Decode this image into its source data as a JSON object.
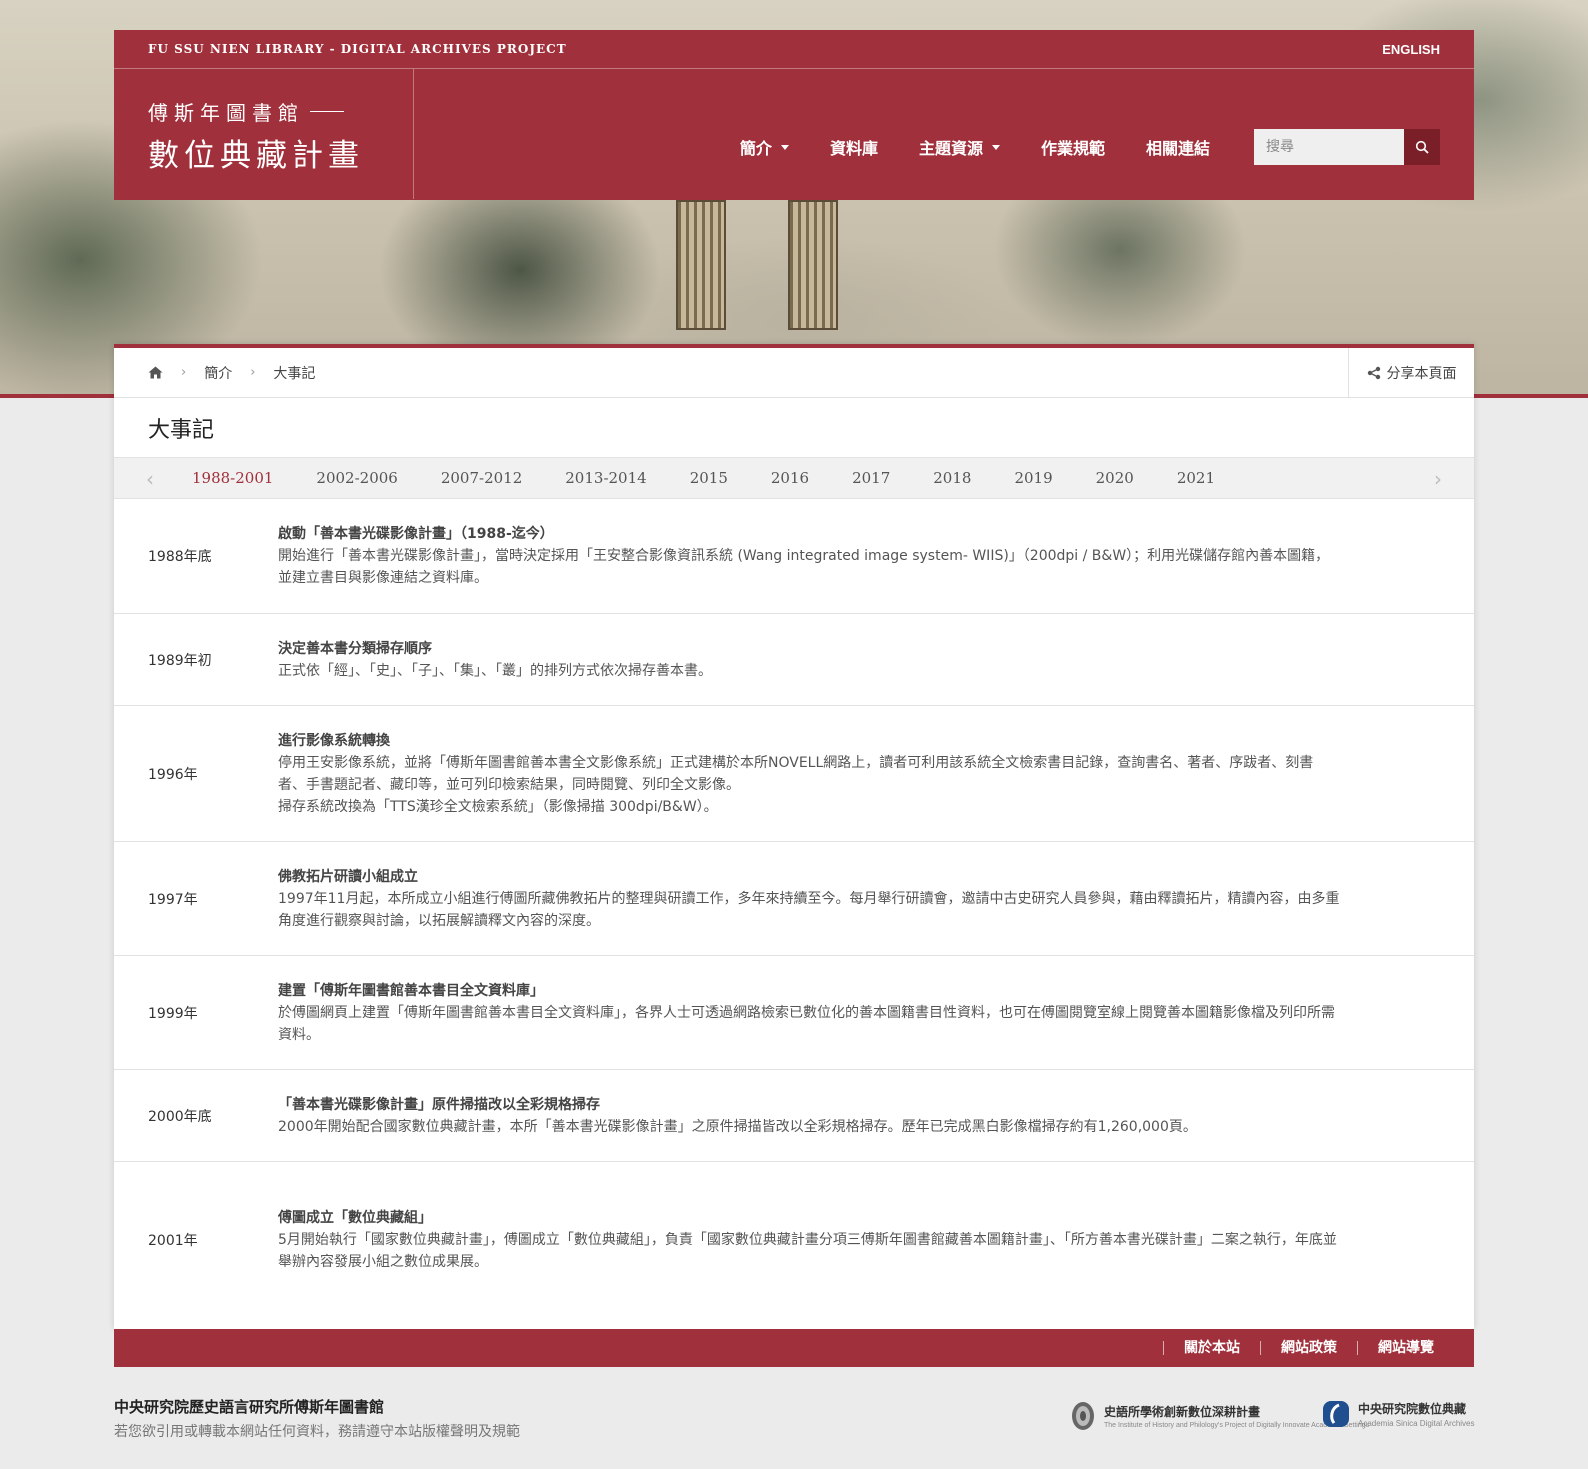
{
  "header": {
    "project_label": "FU SSU NIEN LIBRARY - DIGITAL ARCHIVES PROJECT",
    "language_link": "ENGLISH",
    "logo_line1": "傅斯年圖書館",
    "logo_line2": "數位典藏計畫",
    "nav": [
      {
        "label": "簡介",
        "has_dropdown": true
      },
      {
        "label": "資料庫",
        "has_dropdown": false
      },
      {
        "label": "主題資源",
        "has_dropdown": true
      },
      {
        "label": "作業規範",
        "has_dropdown": false
      },
      {
        "label": "相關連結",
        "has_dropdown": false
      }
    ],
    "search_placeholder": "搜尋",
    "search_icon": "search-icon"
  },
  "breadcrumb": {
    "home_icon": "home-icon",
    "items": [
      "簡介",
      "大事記"
    ],
    "share_label": "分享本頁面",
    "share_icon": "share-icon"
  },
  "page": {
    "title": "大事記",
    "tabs": [
      "1988-2001",
      "2002-2006",
      "2007-2012",
      "2013-2014",
      "2015",
      "2016",
      "2017",
      "2018",
      "2019",
      "2020",
      "2021"
    ],
    "active_tab": 0,
    "entries": [
      {
        "year": "1988年底",
        "heading": "啟動「善本書光碟影像計畫」（1988-迄今）",
        "lines": [
          "開始進行「善本書光碟影像計畫」，當時決定採用「王安整合影像資訊系統 (Wang integrated image system- WIIS)」（200dpi / B&W）；利用光碟儲存館內善本圖籍，並建立書目與影像連結之資料庫。"
        ]
      },
      {
        "year": "1989年初",
        "heading": "決定善本書分類掃存順序",
        "lines": [
          "正式依「經」、「史」、「子」、「集」、「叢」的排列方式依次掃存善本書。"
        ]
      },
      {
        "year": "1996年",
        "heading": "進行影像系統轉換",
        "lines": [
          "停用王安影像系統，並將「傅斯年圖書館善本書全文影像系統」正式建構於本所NOVELL網路上，讀者可利用該系統全文檢索書目記錄，查詢書名、著者、序跋者、刻書者、手書題記者、藏印等，並可列印檢索結果，同時閱覽、列印全文影像。",
          "掃存系統改換為「TTS漢珍全文檢索系統」（影像掃描 300dpi/B&W）。"
        ]
      },
      {
        "year": "1997年",
        "heading": "佛教拓片研讀小組成立",
        "lines": [
          "1997年11月起，本所成立小組進行傅圖所藏佛教拓片的整理與研讀工作，多年來持續至今。每月舉行研讀會，邀請中古史研究人員參與，藉由釋讀拓片，精讀內容，由多重角度進行觀察與討論，以拓展解讀釋文內容的深度。"
        ]
      },
      {
        "year": "1999年",
        "heading": "建置「傅斯年圖書館善本書目全文資料庫」",
        "lines": [
          "於傅圖網頁上建置「傅斯年圖書館善本書目全文資料庫」，各界人士可透過網路檢索已數位化的善本圖籍書目性資料，也可在傅圖閱覽室線上閱覽善本圖籍影像檔及列印所需資料。"
        ]
      },
      {
        "year": "2000年底",
        "heading": "「善本書光碟影像計畫」原件掃描改以全彩規格掃存",
        "lines": [
          "2000年開始配合國家數位典藏計畫，本所「善本書光碟影像計畫」之原件掃描皆改以全彩規格掃存。歷年已完成黑白影像檔掃存約有1,260,000頁。"
        ]
      },
      {
        "year": "2001年",
        "heading": "傅圖成立「數位典藏組」",
        "lines": [
          "5月開始執行「國家數位典藏計畫」，傅圖成立「數位典藏組」，負責「國家數位典藏計畫分項三傅斯年圖書館藏善本圖籍計畫」、「所方善本書光碟計畫」二案之執行，年底並舉辦內容發展小組之數位成果展。"
        ]
      }
    ]
  },
  "footer": {
    "links": [
      "關於本站",
      "網站政策",
      "網站導覽"
    ],
    "org_name": "中央研究院歷史語言研究所傅斯年圖書館",
    "copyright_note": "若您欲引用或轉載本網站任何資料，務請遵守本站版權聲明及規範",
    "partners": [
      {
        "name": "史語所學術創新數位深耕計畫",
        "sub": "The Institute of History and Philology's Project of Digitally Innovate Academic Settings"
      },
      {
        "name": "中央研究院數位典藏",
        "sub": "Academia Sinica Digital Archives"
      }
    ]
  },
  "colors": {
    "brand": "#a0303b",
    "brand_dark": "#7a1e28",
    "page_bg": "#ebebeb"
  }
}
